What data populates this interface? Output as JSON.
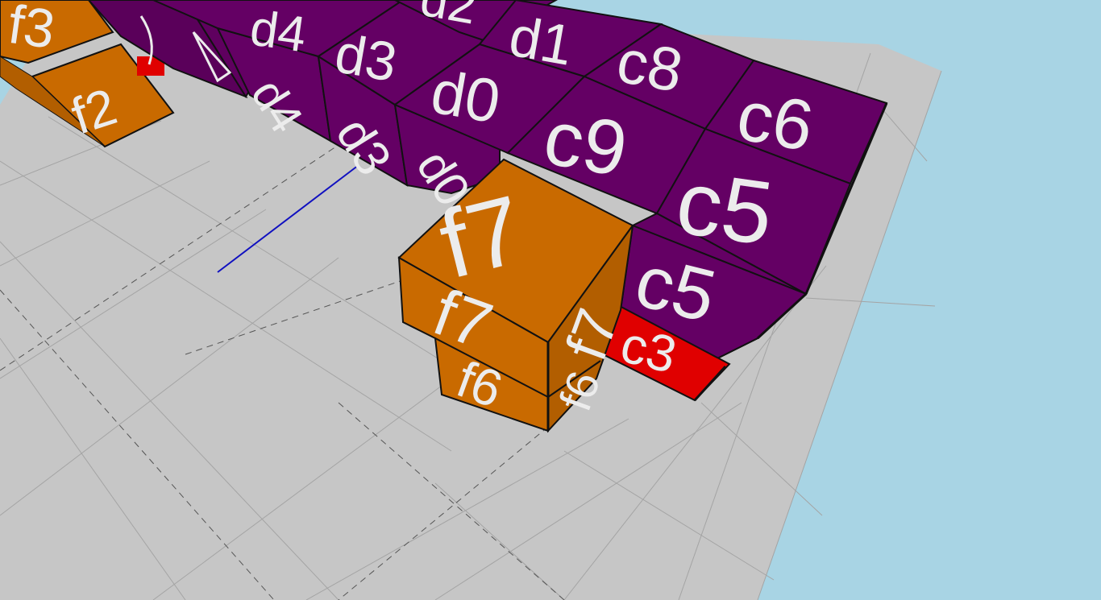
{
  "scene": {
    "colors": {
      "sky": "#a8d4e4",
      "ground": "#c6c6c6",
      "orange": "#c96a00",
      "purple": "#640064",
      "red": "#e00000",
      "edge": "#111111",
      "label": "#ececec",
      "axis": "#1010c0"
    }
  },
  "blocks": {
    "f3": "f3",
    "f2": "f2",
    "d4_top": "d4",
    "d4_side": "d4",
    "d3_top": "d3",
    "d3_side": "d3",
    "d2_top": "d2",
    "d1_top": "d1",
    "d0_top": "d0",
    "d0_side": "d0",
    "c8_top": "c8",
    "c9_top": "c9",
    "c6_top": "c6",
    "c5_top": "c5",
    "c5_side": "c5",
    "c3_side": "c3",
    "f7_top": "f7",
    "f7_front": "f7",
    "f7_right": "f7",
    "f6_front": "f6",
    "f6_right": "f6"
  }
}
